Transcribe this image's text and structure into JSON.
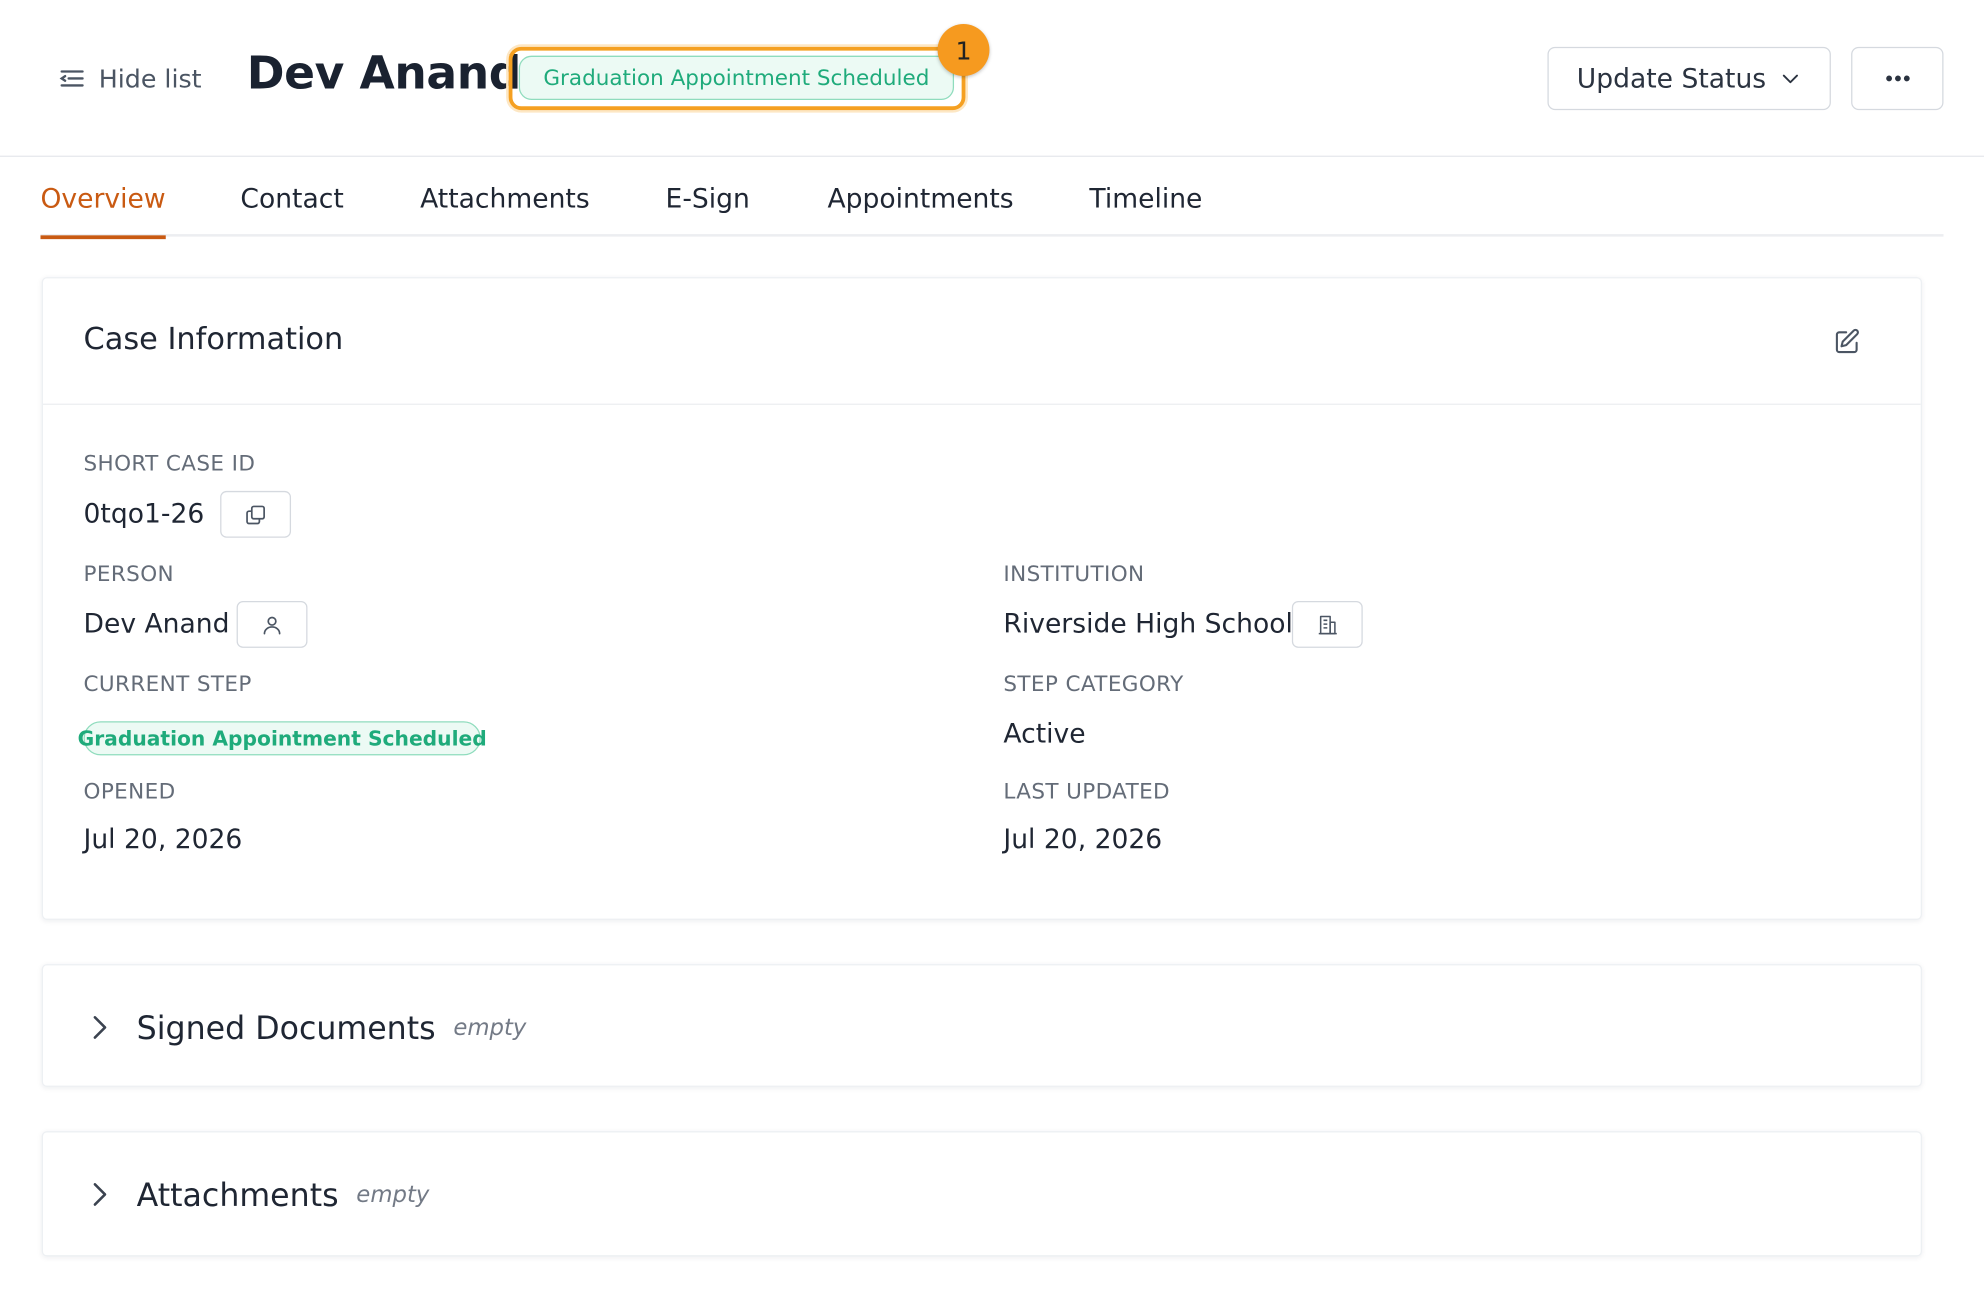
{
  "header": {
    "hide_list_label": "Hide list",
    "title": "Dev Anand",
    "status": "Graduation Appointment Scheduled",
    "badge_count": "1",
    "update_status_label": "Update Status"
  },
  "tabs": [
    {
      "label": "Overview",
      "active": true
    },
    {
      "label": "Contact"
    },
    {
      "label": "Attachments"
    },
    {
      "label": "E-Sign"
    },
    {
      "label": "Appointments"
    },
    {
      "label": "Timeline"
    }
  ],
  "case_info": {
    "title": "Case Information",
    "short_case_id_label": "SHORT CASE ID",
    "short_case_id": "0tqo1-26",
    "person_label": "PERSON",
    "person": "Dev Anand",
    "institution_label": "INSTITUTION",
    "institution": "Riverside High School",
    "current_step_label": "CURRENT STEP",
    "current_step": "Graduation Appointment Scheduled",
    "step_category_label": "STEP CATEGORY",
    "step_category": "Active",
    "opened_label": "OPENED",
    "opened": "Jul 20, 2026",
    "last_updated_label": "LAST UPDATED",
    "last_updated": "Jul 20, 2026"
  },
  "sections": [
    {
      "title": "Signed Documents",
      "status": "empty"
    },
    {
      "title": "Attachments",
      "status": "empty"
    }
  ],
  "colors": {
    "accent": "#c95a12",
    "status_green": "#1fab7b",
    "highlight_orange": "#f5a021"
  },
  "icons": {
    "hide_list": "list-collapse-icon",
    "update_status": "chevron-down-icon",
    "more": "more-horizontal-icon",
    "edit": "edit-icon",
    "copy": "copy-icon",
    "person": "user-icon",
    "institution": "building-icon",
    "expand": "chevron-right-icon"
  }
}
